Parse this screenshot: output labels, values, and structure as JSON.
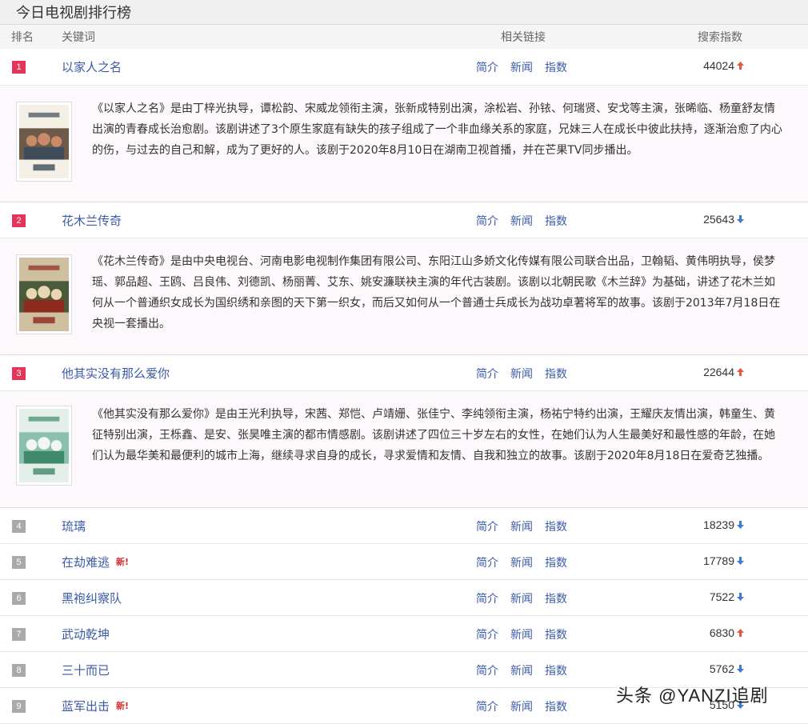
{
  "page_title": "今日电视剧排行榜",
  "columns": {
    "rank": "排名",
    "keyword": "关键词",
    "links": "相关链接",
    "index": "搜索指数"
  },
  "link_labels": {
    "intro": "简介",
    "news": "新闻",
    "index": "指数"
  },
  "new_label": "新!",
  "rows": [
    {
      "rank": "1",
      "keyword": "以家人之名",
      "score": "44024",
      "trend": "up",
      "description": "《以家人之名》是由丁梓光执导，谭松韵、宋威龙领衔主演，张新成特别出演，涂松岩、孙铱、何瑞贤、安戈等主演，张晞临、杨童舒友情出演的青春成长治愈剧。该剧讲述了3个原生家庭有缺失的孩子组成了一个非血缘关系的家庭，兄妹三人在成长中彼此扶持，逐渐治愈了内心的伤，与过去的自己和解，成为了更好的人。该剧于2020年8月10日在湖南卫视首播，并在芒果TV同步播出。"
    },
    {
      "rank": "2",
      "keyword": "花木兰传奇",
      "score": "25643",
      "trend": "down",
      "description": "《花木兰传奇》是由中央电视台、河南电影电视制作集团有限公司、东阳江山多娇文化传媒有限公司联合出品，卫翰韬、黄伟明执导，侯梦瑶、郭品超、王鸥、吕良伟、刘德凯、杨丽菁、艾东、姚安濂联袂主演的年代古装剧。该剧以北朝民歌《木兰辞》为基础，讲述了花木兰如何从一个普通织女成长为国织绣和亲图的天下第一织女，而后又如何从一个普通士兵成长为战功卓著将军的故事。该剧于2013年7月18日在央视一套播出。"
    },
    {
      "rank": "3",
      "keyword": "他其实没有那么爱你",
      "score": "22644",
      "trend": "up",
      "description": "《他其实没有那么爱你》是由王光利执导，宋茜、郑恺、卢靖姗、张佳宁、李纯领衔主演，杨祐宁特约出演，王耀庆友情出演，韩童生、黄征特别出演，王栎鑫、是安、张昊唯主演的都市情感剧。该剧讲述了四位三十岁左右的女性，在她们认为人生最美好和最性感的年龄，在她们认为最华美和最便利的城市上海，继续寻求自身的成长，寻求爱情和友情、自我和独立的故事。该剧于2020年8月18日在爱奇艺独播。"
    },
    {
      "rank": "4",
      "keyword": "琉璃",
      "score": "18239",
      "trend": "down",
      "is_new": false
    },
    {
      "rank": "5",
      "keyword": "在劫难逃",
      "score": "17789",
      "trend": "down",
      "is_new": true
    },
    {
      "rank": "6",
      "keyword": "黑袍纠察队",
      "score": "7522",
      "trend": "down",
      "is_new": false
    },
    {
      "rank": "7",
      "keyword": "武动乾坤",
      "score": "6830",
      "trend": "up",
      "is_new": false
    },
    {
      "rank": "8",
      "keyword": "三十而已",
      "score": "5762",
      "trend": "down",
      "is_new": false
    },
    {
      "rank": "9",
      "keyword": "蓝军出击",
      "score": "5150",
      "trend": "down",
      "is_new": true
    }
  ],
  "watermark": "头条 @YANZI追剧",
  "colors": {
    "up": "#e8553e",
    "down": "#3a7bd5",
    "badge_top": "#e6335a",
    "badge_normal": "#a9a9a9",
    "link": "#3b5aa8"
  }
}
